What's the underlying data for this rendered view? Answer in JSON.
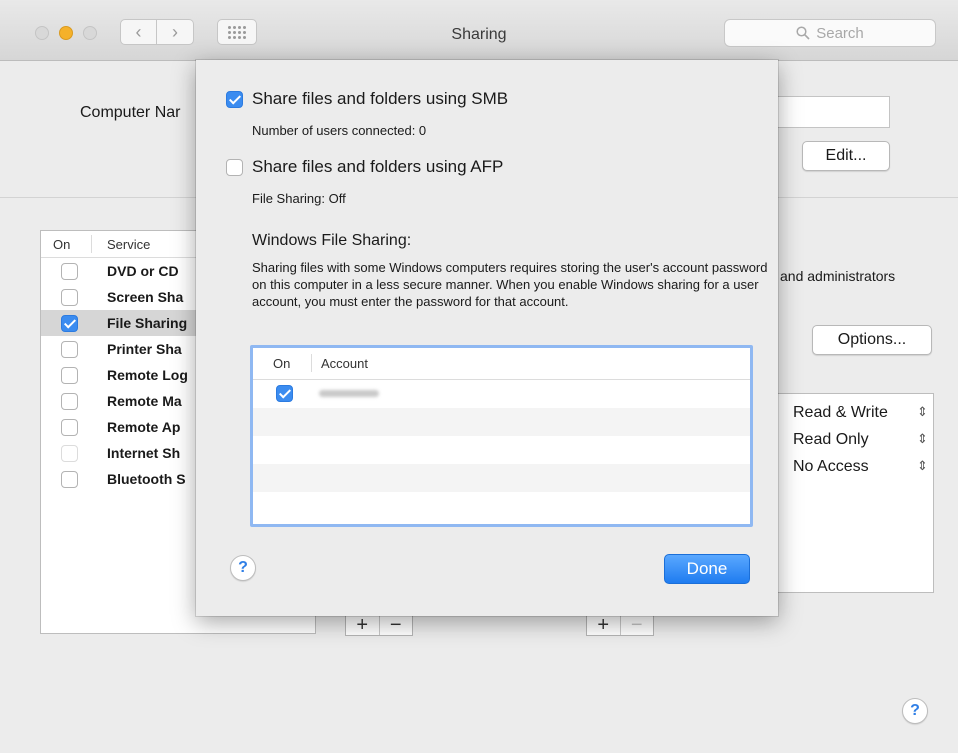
{
  "window": {
    "title": "Sharing",
    "search_placeholder": "Search"
  },
  "pane": {
    "computer_name_label": "Computer Nar",
    "edit_button": "Edit...",
    "options_button": "Options...",
    "admins_text": "and administrators",
    "services_header": {
      "on": "On",
      "service": "Service"
    },
    "services": [
      {
        "label": "DVD or CD",
        "checked": false,
        "selected": false
      },
      {
        "label": "Screen Sha",
        "checked": false,
        "selected": false
      },
      {
        "label": "File Sharing",
        "checked": true,
        "selected": true
      },
      {
        "label": "Printer Sha",
        "checked": false,
        "selected": false
      },
      {
        "label": "Remote Log",
        "checked": false,
        "selected": false
      },
      {
        "label": "Remote Ma",
        "checked": false,
        "selected": false
      },
      {
        "label": "Remote Ap",
        "checked": false,
        "selected": false
      },
      {
        "label": "Internet Sh",
        "checked": false,
        "selected": false,
        "faint": true
      },
      {
        "label": "Bluetooth S",
        "checked": false,
        "selected": false
      }
    ],
    "permissions": [
      "Read & Write",
      "Read Only",
      "No Access"
    ],
    "plus": "+",
    "minus": "−"
  },
  "sheet": {
    "smb_label": "Share files and folders using SMB",
    "smb_checked": true,
    "smb_status": "Number of users connected: 0",
    "afp_label": "Share files and folders using AFP",
    "afp_checked": false,
    "afp_status": "File Sharing: Off",
    "windows_heading": "Windows File Sharing:",
    "windows_desc": "Sharing files with some Windows computers requires storing the user's account password on this computer in a less secure manner.  When you enable Windows sharing for a user account, you must enter the password for that account.",
    "table_header": {
      "on": "On",
      "account": "Account"
    },
    "accounts": [
      {
        "checked": true
      }
    ],
    "done_button": "Done",
    "help": "?"
  },
  "colors": {
    "accent": "#3b8cf0",
    "minimize": "#f5b12a"
  }
}
